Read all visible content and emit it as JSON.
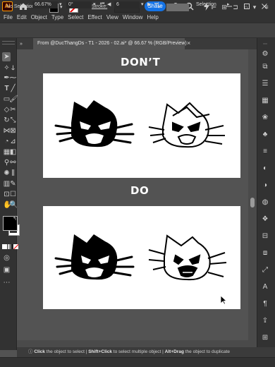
{
  "title_bar": {
    "app_logo": "Ai",
    "share_label": "Share",
    "icons": [
      "home-icon",
      "bell-icon",
      "search-icon",
      "bolt-icon",
      "minimize-icon",
      "maximize-icon",
      "close-icon"
    ]
  },
  "menu": {
    "items": [
      "File",
      "Edit",
      "Object",
      "Type",
      "Select",
      "Effect",
      "View",
      "Window",
      "Help"
    ]
  },
  "control_bar": {
    "selection_label": "No Selection",
    "fill_color": "#000000",
    "stroke_color": "#ffffff",
    "stroke_label": "Stroke:"
  },
  "document": {
    "tab_label": "From @DucThangDs - T1 - 2026 - 02.ai* @ 66.67 % (RGB/Preview)",
    "close_label": "×"
  },
  "artboards": {
    "dont_heading": "DON’T",
    "do_heading": "DO"
  },
  "hint_bar": {
    "click": "Click",
    "click_text": "the object to select",
    "shift": "Shift+Click",
    "shift_text": "to select multiple object",
    "alt": "Alt+Drag",
    "alt_text": "the object to duplicate"
  },
  "status_bar": {
    "zoom": "66.67%",
    "rotation": "0°",
    "artboard_number": "6",
    "mode": "Selection"
  },
  "colors": {
    "accent": "#1473e6",
    "app_logo": "#ff9a00"
  }
}
